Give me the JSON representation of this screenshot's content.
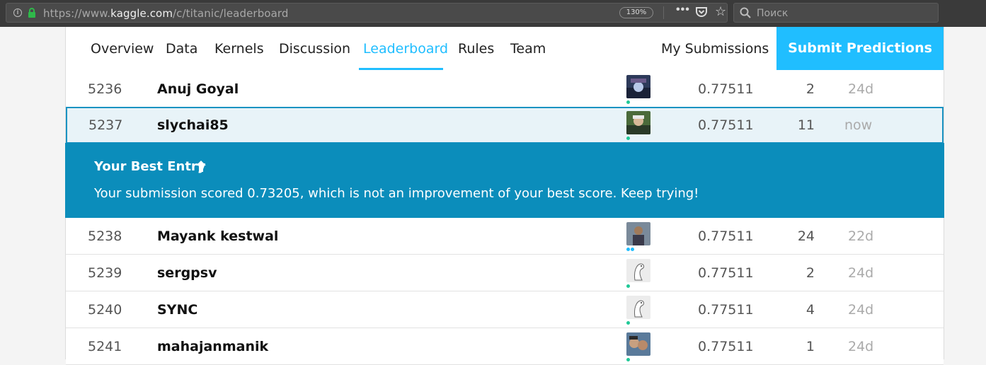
{
  "browser": {
    "url_prefix": "https://www.",
    "url_domain": "kaggle.com",
    "url_path": "/c/titanic/leaderboard",
    "zoom": "130%",
    "search_placeholder": "Поиск"
  },
  "nav": {
    "tabs": [
      {
        "label": "Overview"
      },
      {
        "label": "Data"
      },
      {
        "label": "Kernels"
      },
      {
        "label": "Discussion"
      },
      {
        "label": "Leaderboard"
      },
      {
        "label": "Rules"
      },
      {
        "label": "Team"
      }
    ],
    "active_tab": "Leaderboard",
    "my_submissions": "My Submissions",
    "submit_label": "Submit Predictions"
  },
  "leaderboard": {
    "rows": [
      {
        "rank": "5236",
        "team": "Anuj Goyal",
        "score": "0.77511",
        "entries": "2",
        "last": "24d"
      },
      {
        "rank": "5237",
        "team": "slychai85",
        "score": "0.77511",
        "entries": "11",
        "last": "now"
      },
      {
        "rank": "5238",
        "team": "Mayank kestwal",
        "score": "0.77511",
        "entries": "24",
        "last": "22d"
      },
      {
        "rank": "5239",
        "team": "sergpsv",
        "score": "0.77511",
        "entries": "2",
        "last": "24d"
      },
      {
        "rank": "5240",
        "team": "SYNC",
        "score": "0.77511",
        "entries": "4",
        "last": "24d"
      },
      {
        "rank": "5241",
        "team": "mahajanmanik",
        "score": "0.77511",
        "entries": "1",
        "last": "24d"
      }
    ]
  },
  "banner": {
    "title": "Your Best Entry",
    "message": "Your submission scored 0.73205, which is not an improvement of your best score. Keep trying!"
  },
  "colors": {
    "accent": "#20beff",
    "banner_bg": "#0b8dbb",
    "highlight_row": "#e8f3f8",
    "tier_dot": "#20c997"
  }
}
